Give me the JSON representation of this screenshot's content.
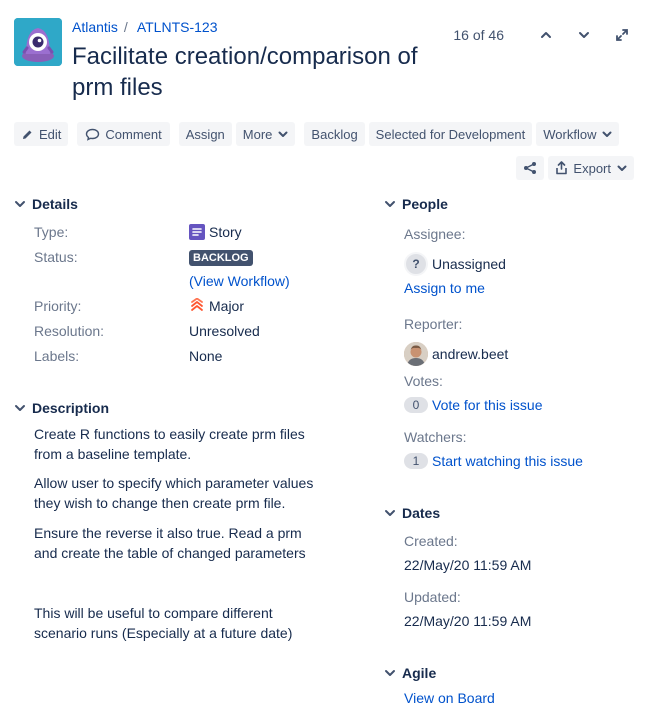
{
  "breadcrumb": {
    "project": "Atlantis",
    "separator": "/",
    "issue_key": "ATLNTS-123"
  },
  "issue": {
    "title": "Facilitate creation/comparison of prm files"
  },
  "pager": {
    "count": "16 of 46"
  },
  "toolbar": {
    "edit": "Edit",
    "comment": "Comment",
    "assign": "Assign",
    "more": "More",
    "backlog": "Backlog",
    "selected_for_dev": "Selected for Development",
    "workflow": "Workflow",
    "export": "Export"
  },
  "details": {
    "heading": "Details",
    "type_label": "Type:",
    "type_value": "Story",
    "status_label": "Status:",
    "status_value": "BACKLOG",
    "view_workflow_open": "(",
    "view_workflow": "View Workflow",
    "view_workflow_close": ")",
    "priority_label": "Priority:",
    "priority_value": "Major",
    "resolution_label": "Resolution:",
    "resolution_value": "Unresolved",
    "labels_label": "Labels:",
    "labels_value": "None"
  },
  "description": {
    "heading": "Description",
    "paragraphs": [
      "Create R functions to easily create prm files from a baseline template.",
      "Allow user to specify which parameter values they wish to change then create prm file.",
      "Ensure the reverse it also true. Read a prm and create the table of changed parameters",
      "This will be useful to compare different scenario runs (Especially at a future date)"
    ]
  },
  "people": {
    "heading": "People",
    "assignee_label": "Assignee:",
    "assignee_value": "Unassigned",
    "assignee_icon": "?",
    "assign_to_me": "Assign to me",
    "reporter_label": "Reporter:",
    "reporter_value": "andrew.beet",
    "votes_label": "Votes:",
    "votes_count": "0",
    "vote_link": "Vote for this issue",
    "watchers_label": "Watchers:",
    "watchers_count": "1",
    "watch_link": "Start watching this issue"
  },
  "dates": {
    "heading": "Dates",
    "created_label": "Created:",
    "created_value": "22/May/20 11:59 AM",
    "updated_label": "Updated:",
    "updated_value": "22/May/20 11:59 AM"
  },
  "agile": {
    "heading": "Agile",
    "view_on_board": "View on Board"
  },
  "colors": {
    "link": "#0052cc",
    "text": "#172b4d",
    "muted": "#6b778c",
    "button_bg": "#f4f5f7",
    "lozenge": "#42526e",
    "story": "#6554c0",
    "priority": "#ff5630",
    "project_avatar": "#2fa8c8"
  },
  "icons": [
    "project-avatar",
    "pencil-icon",
    "speech-bubble-icon",
    "chevron-down-icon",
    "share-icon",
    "export-icon",
    "chevron-up-icon",
    "expand-icon",
    "story-icon",
    "major-priority-icon",
    "unknown-user-icon",
    "user-avatar"
  ]
}
